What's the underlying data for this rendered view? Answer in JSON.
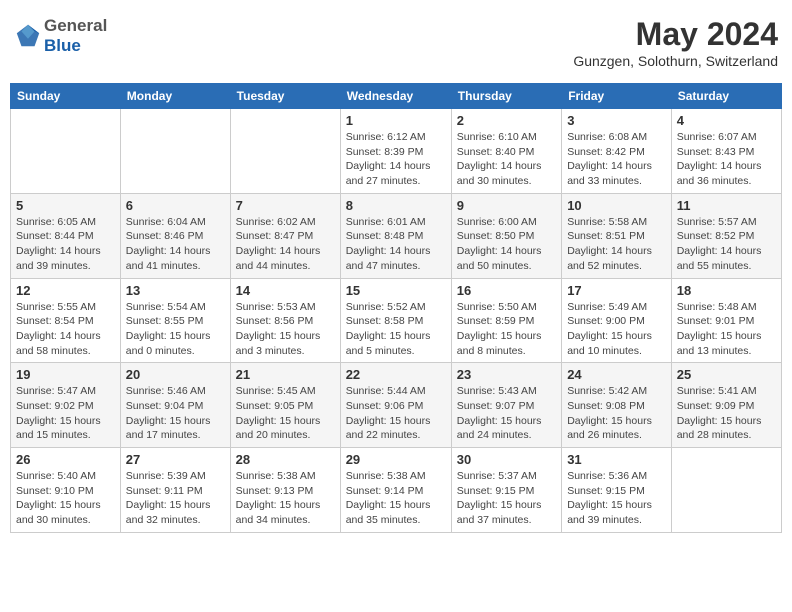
{
  "header": {
    "logo_general": "General",
    "logo_blue": "Blue",
    "title": "May 2024",
    "subtitle": "Gunzgen, Solothurn, Switzerland"
  },
  "weekdays": [
    "Sunday",
    "Monday",
    "Tuesday",
    "Wednesday",
    "Thursday",
    "Friday",
    "Saturday"
  ],
  "weeks": [
    [
      {
        "day": "",
        "detail": ""
      },
      {
        "day": "",
        "detail": ""
      },
      {
        "day": "",
        "detail": ""
      },
      {
        "day": "1",
        "detail": "Sunrise: 6:12 AM\nSunset: 8:39 PM\nDaylight: 14 hours\nand 27 minutes."
      },
      {
        "day": "2",
        "detail": "Sunrise: 6:10 AM\nSunset: 8:40 PM\nDaylight: 14 hours\nand 30 minutes."
      },
      {
        "day": "3",
        "detail": "Sunrise: 6:08 AM\nSunset: 8:42 PM\nDaylight: 14 hours\nand 33 minutes."
      },
      {
        "day": "4",
        "detail": "Sunrise: 6:07 AM\nSunset: 8:43 PM\nDaylight: 14 hours\nand 36 minutes."
      }
    ],
    [
      {
        "day": "5",
        "detail": "Sunrise: 6:05 AM\nSunset: 8:44 PM\nDaylight: 14 hours\nand 39 minutes."
      },
      {
        "day": "6",
        "detail": "Sunrise: 6:04 AM\nSunset: 8:46 PM\nDaylight: 14 hours\nand 41 minutes."
      },
      {
        "day": "7",
        "detail": "Sunrise: 6:02 AM\nSunset: 8:47 PM\nDaylight: 14 hours\nand 44 minutes."
      },
      {
        "day": "8",
        "detail": "Sunrise: 6:01 AM\nSunset: 8:48 PM\nDaylight: 14 hours\nand 47 minutes."
      },
      {
        "day": "9",
        "detail": "Sunrise: 6:00 AM\nSunset: 8:50 PM\nDaylight: 14 hours\nand 50 minutes."
      },
      {
        "day": "10",
        "detail": "Sunrise: 5:58 AM\nSunset: 8:51 PM\nDaylight: 14 hours\nand 52 minutes."
      },
      {
        "day": "11",
        "detail": "Sunrise: 5:57 AM\nSunset: 8:52 PM\nDaylight: 14 hours\nand 55 minutes."
      }
    ],
    [
      {
        "day": "12",
        "detail": "Sunrise: 5:55 AM\nSunset: 8:54 PM\nDaylight: 14 hours\nand 58 minutes."
      },
      {
        "day": "13",
        "detail": "Sunrise: 5:54 AM\nSunset: 8:55 PM\nDaylight: 15 hours\nand 0 minutes."
      },
      {
        "day": "14",
        "detail": "Sunrise: 5:53 AM\nSunset: 8:56 PM\nDaylight: 15 hours\nand 3 minutes."
      },
      {
        "day": "15",
        "detail": "Sunrise: 5:52 AM\nSunset: 8:58 PM\nDaylight: 15 hours\nand 5 minutes."
      },
      {
        "day": "16",
        "detail": "Sunrise: 5:50 AM\nSunset: 8:59 PM\nDaylight: 15 hours\nand 8 minutes."
      },
      {
        "day": "17",
        "detail": "Sunrise: 5:49 AM\nSunset: 9:00 PM\nDaylight: 15 hours\nand 10 minutes."
      },
      {
        "day": "18",
        "detail": "Sunrise: 5:48 AM\nSunset: 9:01 PM\nDaylight: 15 hours\nand 13 minutes."
      }
    ],
    [
      {
        "day": "19",
        "detail": "Sunrise: 5:47 AM\nSunset: 9:02 PM\nDaylight: 15 hours\nand 15 minutes."
      },
      {
        "day": "20",
        "detail": "Sunrise: 5:46 AM\nSunset: 9:04 PM\nDaylight: 15 hours\nand 17 minutes."
      },
      {
        "day": "21",
        "detail": "Sunrise: 5:45 AM\nSunset: 9:05 PM\nDaylight: 15 hours\nand 20 minutes."
      },
      {
        "day": "22",
        "detail": "Sunrise: 5:44 AM\nSunset: 9:06 PM\nDaylight: 15 hours\nand 22 minutes."
      },
      {
        "day": "23",
        "detail": "Sunrise: 5:43 AM\nSunset: 9:07 PM\nDaylight: 15 hours\nand 24 minutes."
      },
      {
        "day": "24",
        "detail": "Sunrise: 5:42 AM\nSunset: 9:08 PM\nDaylight: 15 hours\nand 26 minutes."
      },
      {
        "day": "25",
        "detail": "Sunrise: 5:41 AM\nSunset: 9:09 PM\nDaylight: 15 hours\nand 28 minutes."
      }
    ],
    [
      {
        "day": "26",
        "detail": "Sunrise: 5:40 AM\nSunset: 9:10 PM\nDaylight: 15 hours\nand 30 minutes."
      },
      {
        "day": "27",
        "detail": "Sunrise: 5:39 AM\nSunset: 9:11 PM\nDaylight: 15 hours\nand 32 minutes."
      },
      {
        "day": "28",
        "detail": "Sunrise: 5:38 AM\nSunset: 9:13 PM\nDaylight: 15 hours\nand 34 minutes."
      },
      {
        "day": "29",
        "detail": "Sunrise: 5:38 AM\nSunset: 9:14 PM\nDaylight: 15 hours\nand 35 minutes."
      },
      {
        "day": "30",
        "detail": "Sunrise: 5:37 AM\nSunset: 9:15 PM\nDaylight: 15 hours\nand 37 minutes."
      },
      {
        "day": "31",
        "detail": "Sunrise: 5:36 AM\nSunset: 9:15 PM\nDaylight: 15 hours\nand 39 minutes."
      },
      {
        "day": "",
        "detail": ""
      }
    ]
  ]
}
